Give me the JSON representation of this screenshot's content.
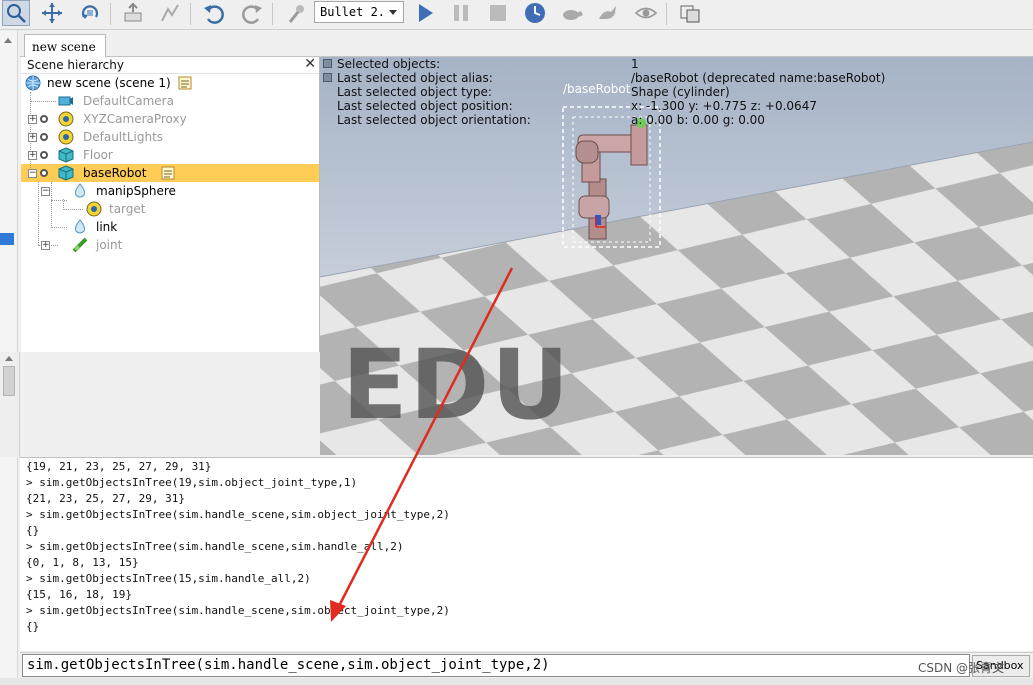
{
  "toolbar": {
    "engine_label": "Bullet 2.",
    "icons": [
      "select-cursor-icon",
      "move-icon",
      "rotate-icon",
      "assembly-icon",
      "path-icon",
      "undo-icon",
      "redo-icon",
      "pen-icon",
      "play-icon",
      "pause-icon",
      "stop-icon",
      "real-time-icon",
      "slow-icon",
      "fast-icon",
      "visibility-icon",
      "page-icon"
    ]
  },
  "tab": {
    "scene_label": "new scene"
  },
  "hierarchy": {
    "title": "Scene hierarchy",
    "close_glyph": "✕",
    "root": "new scene (scene 1)",
    "nodes": [
      "DefaultCamera",
      "XYZCameraProxy",
      "DefaultLights",
      "Floor",
      "baseRobot",
      "manipSphere",
      "target",
      "link",
      "joint"
    ]
  },
  "info": {
    "rows": [
      {
        "key": "Selected objects:",
        "value": "1"
      },
      {
        "key": "Last selected object alias:",
        "value": "/baseRobot   (deprecated name:baseRobot)"
      },
      {
        "key": "Last selected object type:",
        "value": "Shape (cylinder)"
      },
      {
        "key": "Last selected object position:",
        "value": "x: -1.300   y: +0.775   z: +0.0647"
      },
      {
        "key": "Last selected object orientation:",
        "value": "a: 0.00   b: 0.00   g: 0.00"
      }
    ],
    "object_label": "/baseRobot"
  },
  "watermark": "EDU",
  "console": {
    "lines": [
      "{19, 21, 23, 25, 27, 29, 31}",
      "> sim.getObjectsInTree(19,sim.object_joint_type,1)",
      "{21, 23, 25, 27, 29, 31}",
      "> sim.getObjectsInTree(sim.handle_scene,sim.object_joint_type,2)",
      "{}",
      "> sim.getObjectsInTree(sim.handle_scene,sim.handle_all,2)",
      "{0, 1, 8, 13, 15}",
      "> sim.getObjectsInTree(15,sim.handle_all,2)",
      "{15, 16, 18, 19}",
      "> sim.getObjectsInTree(sim.handle_scene,sim.object_joint_type,2)",
      "{}"
    ]
  },
  "command": {
    "input_value": "sim.getObjectsInTree(sim.handle_scene,sim.object_joint_type,2)",
    "sandbox_label": "Sandbox"
  },
  "overlay": {
    "csdn": "CSDN @张青文"
  },
  "colors": {
    "selection": "#ffcc55",
    "arrow": "#e02b20",
    "floor_light": "#e8e8e8",
    "floor_dark": "#b4b4b4"
  }
}
